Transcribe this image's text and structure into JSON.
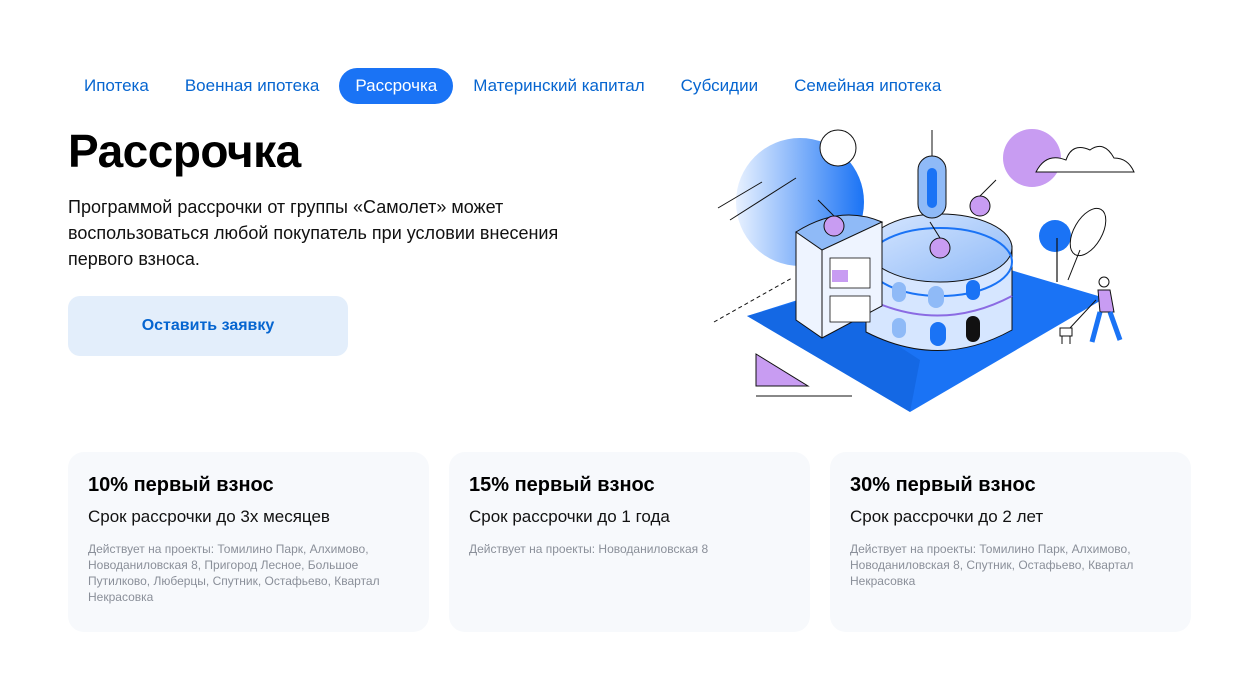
{
  "tabs": [
    {
      "label": "Ипотека",
      "active": false
    },
    {
      "label": "Военная ипотека",
      "active": false
    },
    {
      "label": "Рассрочка",
      "active": true
    },
    {
      "label": "Материнский капитал",
      "active": false
    },
    {
      "label": "Субсидии",
      "active": false
    },
    {
      "label": "Семейная ипотека",
      "active": false
    }
  ],
  "hero": {
    "title": "Рассрочка",
    "text": "Программой рассрочки от группы «Самолет» может воспользоваться любой покупатель при условии внесения первого взноса.",
    "cta_label": "Оставить заявку"
  },
  "cards": [
    {
      "title": "10% первый взнос",
      "subtitle": "Срок рассрочки до 3х месяцев",
      "note": "Действует на проекты: Томилино Парк, Алхимово, Новоданиловская 8, Пригород Лесное, Большое Путилково, Люберцы, Спутник, Остафьево, Квартал Некрасовка"
    },
    {
      "title": "15% первый взнос",
      "subtitle": "Срок рассрочки до 1 года",
      "note": "Действует на проекты: Новоданиловская 8"
    },
    {
      "title": "30% первый взнос",
      "subtitle": "Срок рассрочки до 2 лет",
      "note": "Действует на проекты: Томилино Парк, Алхимово, Новоданиловская 8, Спутник, Остафьево, Квартал Некрасовка"
    }
  ],
  "colors": {
    "accent": "#1a73f5",
    "link": "#0665d0",
    "button_bg": "#e3eefb",
    "card_bg": "#f7f9fc",
    "illustration_violet": "#c89cf2"
  }
}
